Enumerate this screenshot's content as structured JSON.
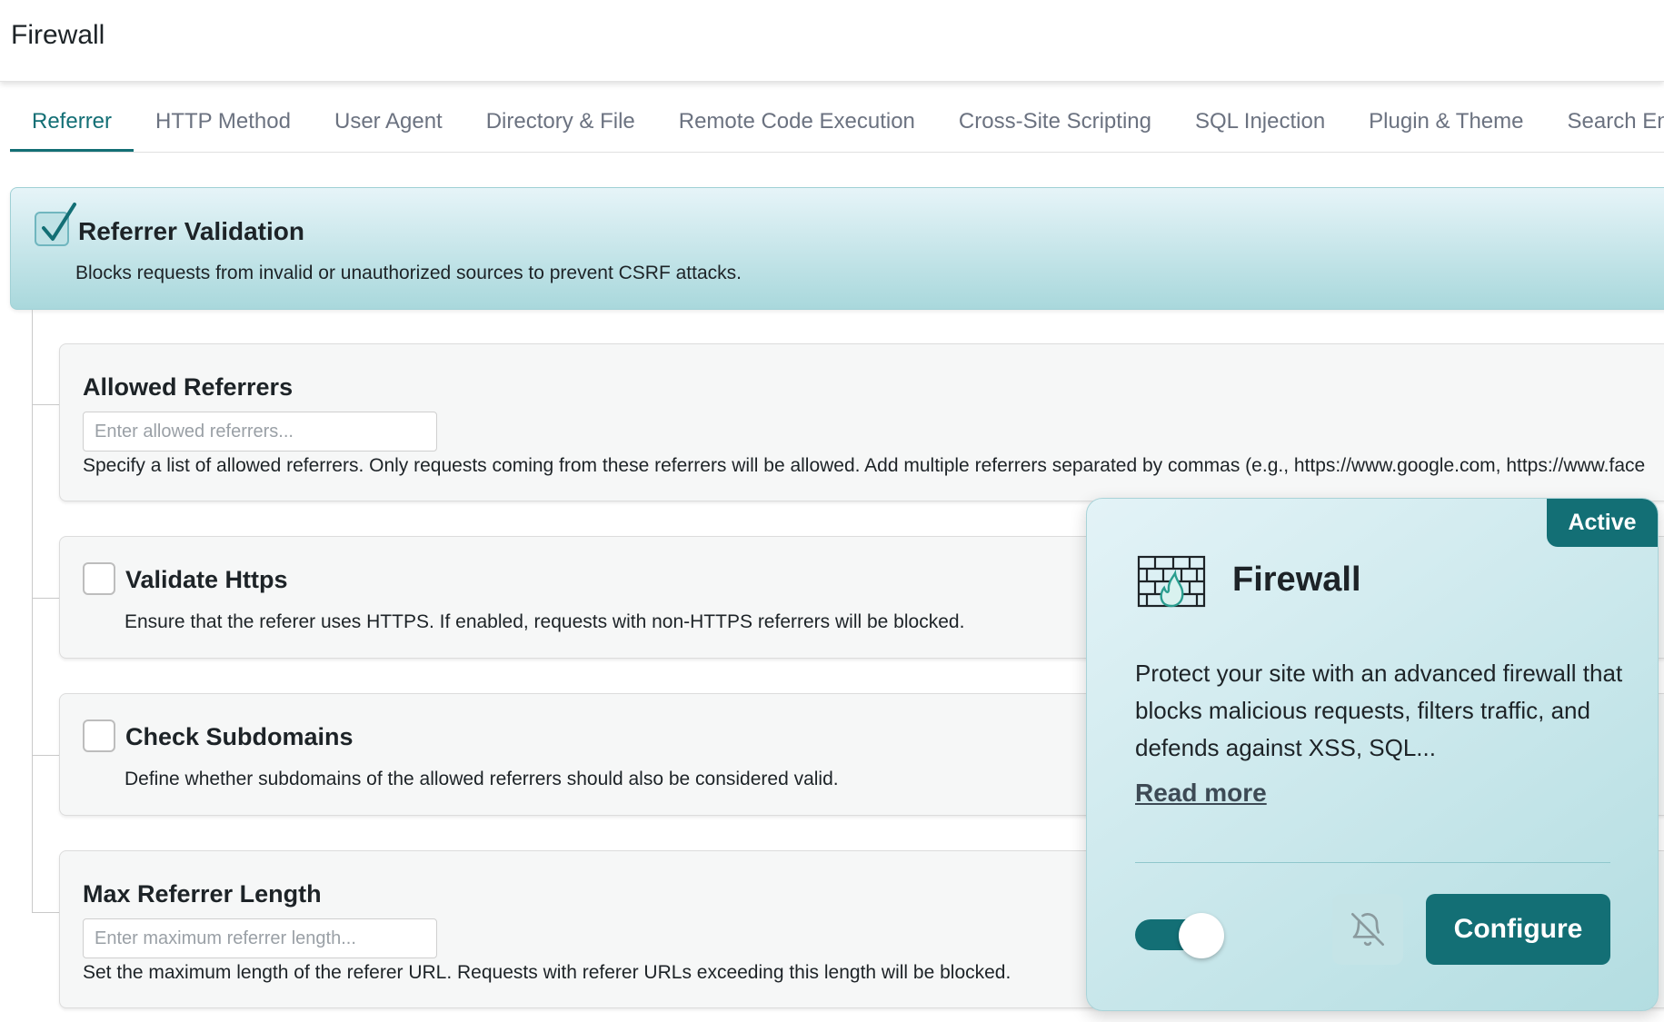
{
  "header": {
    "title": "Firewall"
  },
  "tabs": [
    {
      "label": "Referrer"
    },
    {
      "label": "HTTP Method"
    },
    {
      "label": "User Agent"
    },
    {
      "label": "Directory & File"
    },
    {
      "label": "Remote Code Execution"
    },
    {
      "label": "Cross-Site Scripting"
    },
    {
      "label": "SQL Injection"
    },
    {
      "label": "Plugin & Theme"
    },
    {
      "label": "Search En"
    }
  ],
  "referrer_validation": {
    "title": "Referrer Validation",
    "description": "Blocks requests from invalid or unauthorized sources to prevent CSRF attacks.",
    "checked": true
  },
  "allowed_referrers": {
    "title": "Allowed Referrers",
    "placeholder": "Enter allowed referrers...",
    "value": "",
    "description": "Specify a list of allowed referrers. Only requests coming from these referrers will be allowed. Add multiple referrers separated by commas (e.g., https://www.google.com, https://www.face"
  },
  "validate_https": {
    "title": "Validate Https",
    "description": "Ensure that the referer uses HTTPS. If enabled, requests with non-HTTPS referrers will be blocked.",
    "checked": false
  },
  "check_subdomains": {
    "title": "Check Subdomains",
    "description": "Define whether subdomains of the allowed referrers should also be considered valid.",
    "checked": false
  },
  "max_referrer_length": {
    "title": "Max Referrer Length",
    "placeholder": "Enter maximum referrer length...",
    "value": "",
    "description": "Set the maximum length of the referer URL. Requests with referer URLs exceeding this length will be blocked."
  },
  "popup": {
    "badge": "Active",
    "title": "Firewall",
    "description": "Protect your site with an advanced firewall that blocks malicious requests, filters traffic, and defends against XSS, SQL...",
    "read_more": "Read more",
    "toggle_on": true,
    "configure_label": "Configure",
    "icons": {
      "module": "firewall-brick-flame-icon",
      "notifications": "bell-off-icon"
    }
  },
  "colors": {
    "accent": "#136f75",
    "card_gradient_top": "#e6f4f8",
    "card_gradient_bottom": "#a9d8dc"
  }
}
